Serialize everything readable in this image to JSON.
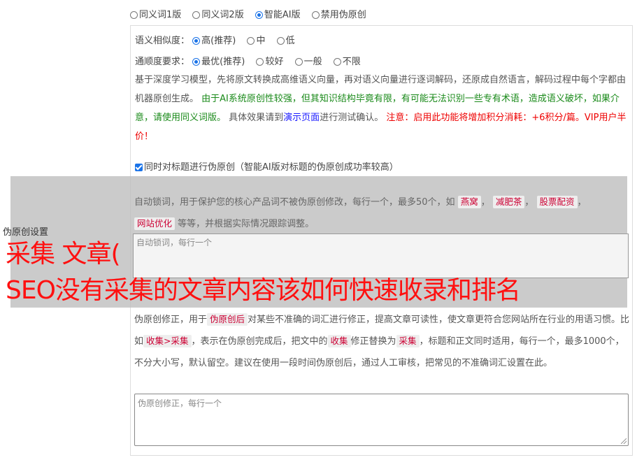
{
  "version_options": [
    {
      "label": "同义词1版",
      "checked": false
    },
    {
      "label": "同义词2版",
      "checked": false
    },
    {
      "label": "智能AI版",
      "checked": true
    },
    {
      "label": "禁用伪原创",
      "checked": false
    }
  ],
  "similarity": {
    "label": "语义相似度：",
    "options": [
      {
        "label": "高(推荐)",
        "checked": true
      },
      {
        "label": "中",
        "checked": false
      },
      {
        "label": "低",
        "checked": false
      }
    ]
  },
  "fluency": {
    "label": "通顺度要求：",
    "options": [
      {
        "label": "最优(推荐)",
        "checked": true
      },
      {
        "label": "较好",
        "checked": false
      },
      {
        "label": "一般",
        "checked": false
      },
      {
        "label": "不限",
        "checked": false
      }
    ]
  },
  "description": {
    "intro": "基于深度学习模型，先将原文转换成高维语义向量，再对语义向量进行逐词解码，还原成自然语言，解码过程中每个字都由机器原创生成。",
    "warning": "由于AI系统原创性较强，但其知识结构毕竟有限，有可能无法识别一些专有术语，造成语义破坏，如果介意，请使用同义词版。",
    "pre_link": "具体效果请到",
    "link": "演示页面",
    "post_link": "进行测试确认。",
    "cost": "注意：启用此功能将增加积分消耗：+6积分/篇。VIP用户半价！"
  },
  "title_option": {
    "label": "同时对标题进行伪原创（智能AI版对标题的伪原创成功率较高）",
    "checked": true
  },
  "settings_label": "伪原创设置",
  "lock": {
    "desc_pre": "自动锁词，用于保护您的核心产品词不被伪原创修改，每行一个，最多50个，如",
    "tags": [
      "燕窝",
      "减肥茶",
      "股票配资",
      "网站优化"
    ],
    "desc_post": "等等，并根据实际情况跟踪调整。",
    "placeholder": "自动锁词，每行一个"
  },
  "headline": {
    "line1": "采集 文章(",
    "line2": "SEO没有采集的文章内容该如何快速收录和排名"
  },
  "fix": {
    "d1": "伪原创修正，用于",
    "tag1": "伪原创后",
    "d2": "对某些不准确的词汇进行修正，提高文章可读性，使文章更符合您网站所在行业的用语习惯。比如",
    "tag2": "收集>采集",
    "d3": "，表示在伪原创完成后，把文中的",
    "tag3": "收集",
    "d4": "修正替换为",
    "tag4": "采集",
    "d5": "，标题和正文同时适用，每行一个，最多1000个，不分大小写，默认留空。建议在使用一段时间伪原创后，通过人工审核，把常见的不准确词汇设置在此。",
    "placeholder": "伪原创修正，每行一个"
  },
  "colors": {
    "accent": "#1a73e8",
    "warning_green": "#1a8a1a",
    "link": "#1a1aff",
    "alert_red": "#ee0000",
    "headline_red": "#ff1010"
  }
}
